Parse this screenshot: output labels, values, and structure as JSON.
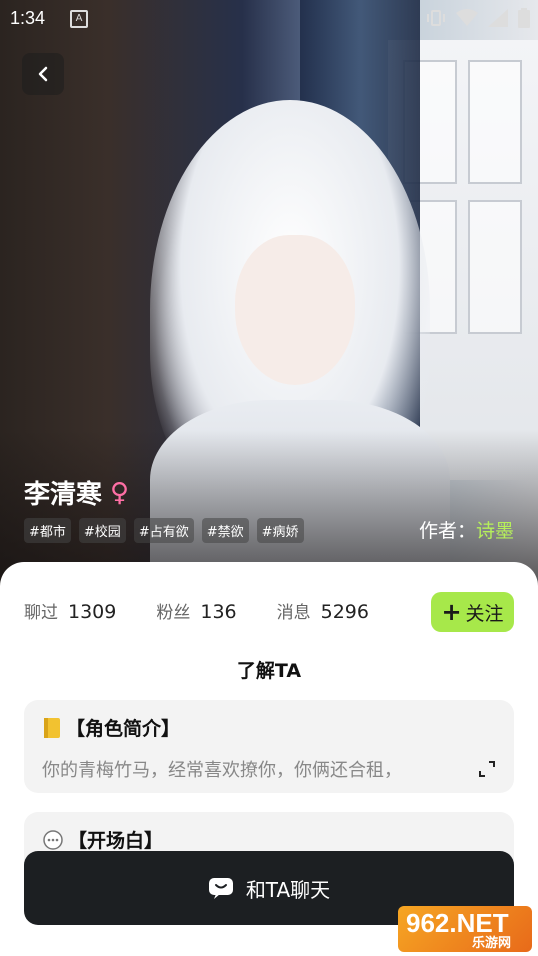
{
  "status_bar": {
    "time": "1:34"
  },
  "profile": {
    "name": "李清寒",
    "gender_symbol": "♀",
    "tags": [
      "#都市",
      "#校园",
      "#占有欲",
      "#禁欲",
      "#病娇"
    ],
    "author_label": "作者：",
    "author_name": "诗墨"
  },
  "stats": [
    {
      "label": "聊过",
      "value": "1309"
    },
    {
      "label": "粉丝",
      "value": "136"
    },
    {
      "label": "消息",
      "value": "5296"
    }
  ],
  "follow_button": {
    "icon": "+",
    "label": "关注"
  },
  "section_title": "了解TA",
  "cards": [
    {
      "icon": "notebook-icon",
      "title": "【角色简介】",
      "text": "你的青梅竹马，经常喜欢撩你，你俩还合租，"
    },
    {
      "icon": "chat-bubble-icon",
      "title": "【开场白】"
    }
  ],
  "chat_button": {
    "label": "和TA聊天"
  },
  "watermark": {
    "big": "962.NET",
    "small": "乐游网"
  },
  "colors": {
    "accent": "#a7e84a",
    "author": "#b6f05a",
    "gender": "#ff6fa5",
    "dark_button": "#1c1f22"
  }
}
